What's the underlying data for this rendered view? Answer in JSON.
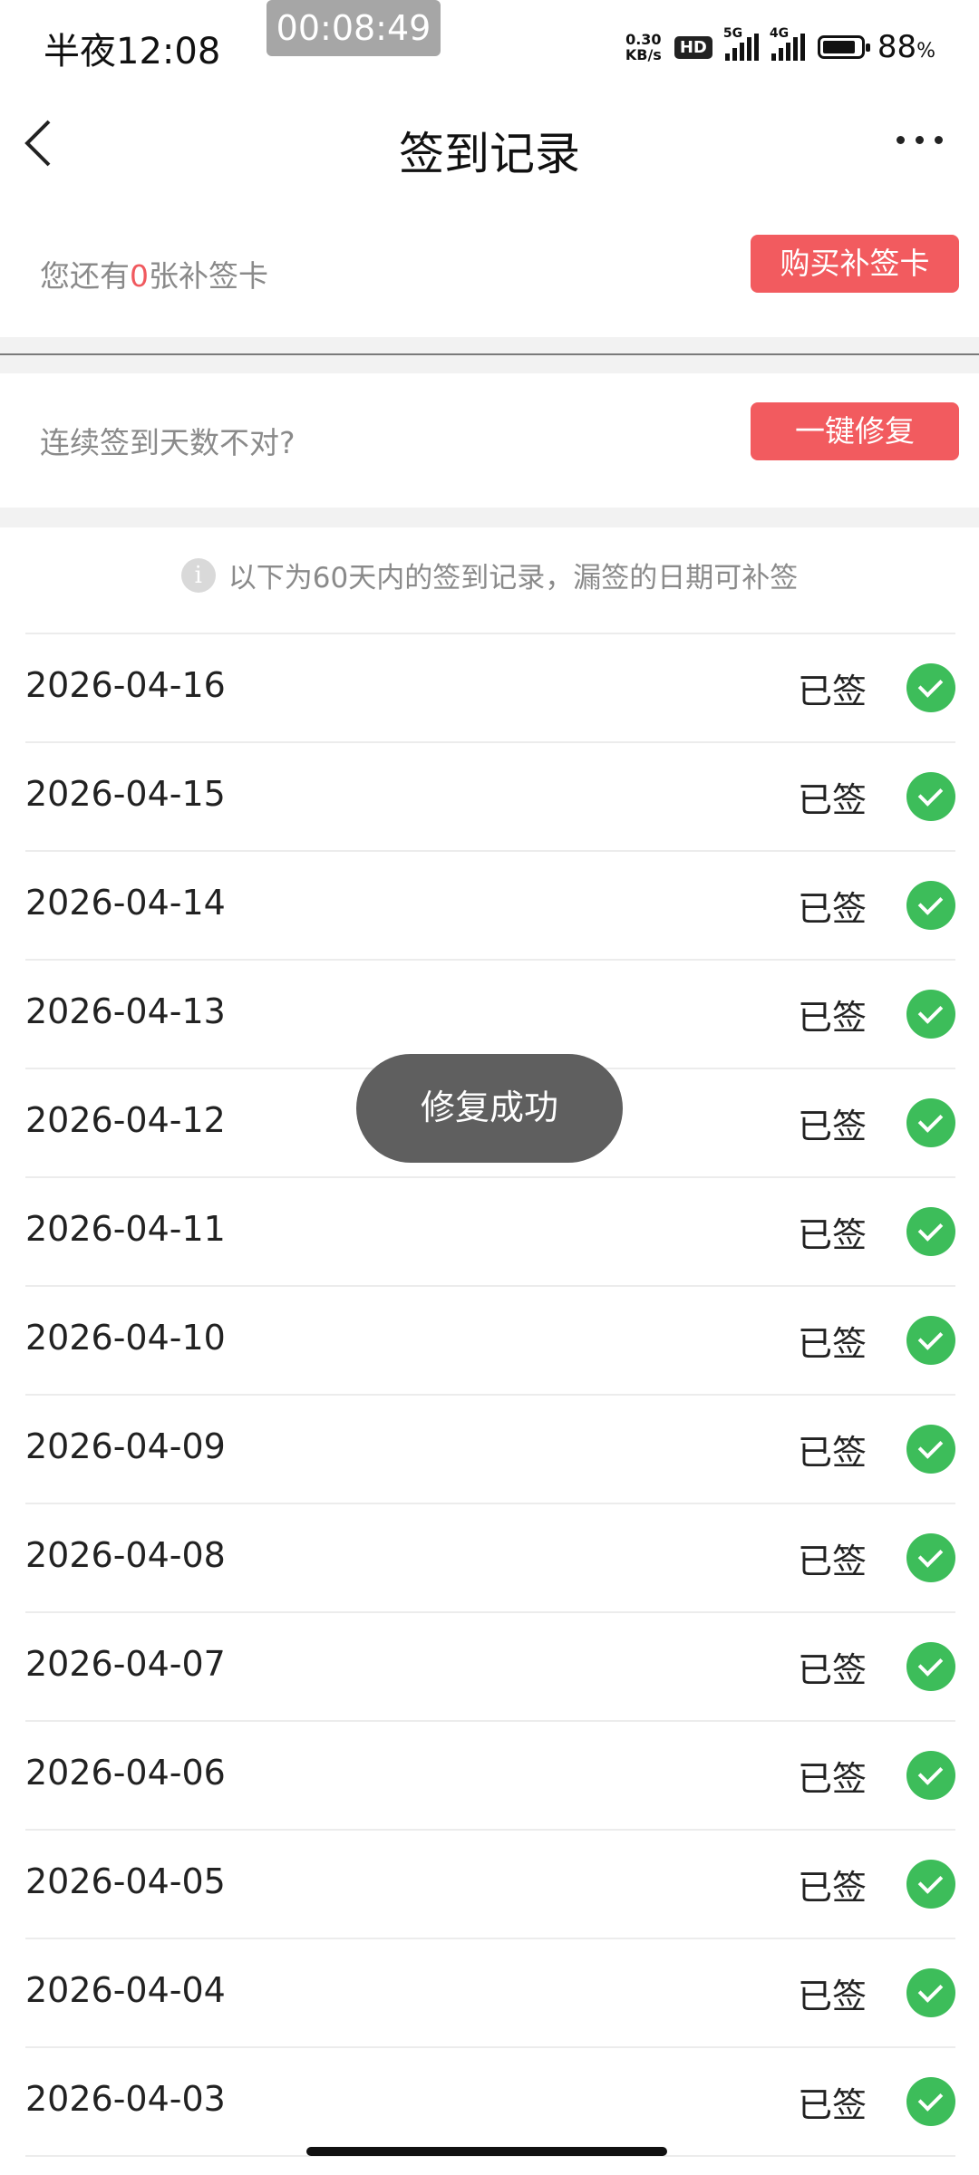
{
  "status_bar": {
    "time": "半夜12:08",
    "timer": "00:08:49",
    "net_speed_value": "0.30",
    "net_speed_unit": "KB/s",
    "hd_badge": "HD",
    "sig1_label": "5G",
    "sig2_label": "4G",
    "battery_level": 0.88,
    "battery_pct": "88",
    "battery_unit": "%"
  },
  "nav": {
    "title": "签到记录"
  },
  "card_supplement": {
    "prefix": "您还有",
    "count": "0",
    "suffix": "张补签卡",
    "button": "购买补签卡"
  },
  "card_repair": {
    "label": "连续签到天数不对?",
    "button": "一键修复"
  },
  "info_text": "以下为60天内的签到记录，漏签的日期可补签",
  "records": [
    {
      "date": "2026-04-16",
      "status": "已签"
    },
    {
      "date": "2026-04-15",
      "status": "已签"
    },
    {
      "date": "2026-04-14",
      "status": "已签"
    },
    {
      "date": "2026-04-13",
      "status": "已签"
    },
    {
      "date": "2026-04-12",
      "status": "已签"
    },
    {
      "date": "2026-04-11",
      "status": "已签"
    },
    {
      "date": "2026-04-10",
      "status": "已签"
    },
    {
      "date": "2026-04-09",
      "status": "已签"
    },
    {
      "date": "2026-04-08",
      "status": "已签"
    },
    {
      "date": "2026-04-07",
      "status": "已签"
    },
    {
      "date": "2026-04-06",
      "status": "已签"
    },
    {
      "date": "2026-04-05",
      "status": "已签"
    },
    {
      "date": "2026-04-04",
      "status": "已签"
    },
    {
      "date": "2026-04-03",
      "status": "已签"
    }
  ],
  "toast": "修复成功",
  "colors": {
    "accent_red": "#f25b5f",
    "check_green": "#3dbd5a",
    "toast_bg": "#5f5f5f"
  }
}
